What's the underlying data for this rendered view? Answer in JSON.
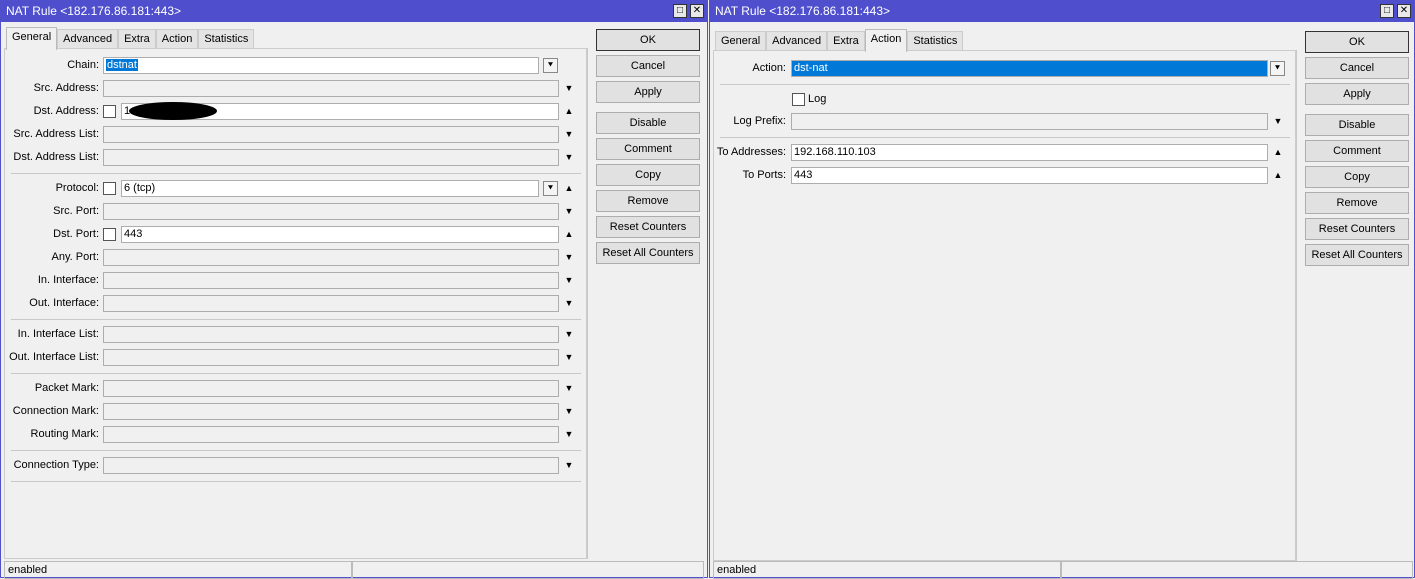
{
  "left": {
    "title": "NAT Rule <182.176.86.181:443>",
    "tabs": [
      "General",
      "Advanced",
      "Extra",
      "Action",
      "Statistics"
    ],
    "active_tab": 0,
    "fields": [
      {
        "label": "Chain:",
        "value": "dstnat",
        "selected": true,
        "dropdown": true,
        "enabled": true
      },
      {
        "label": "Src. Address:",
        "value": "",
        "arrow": "down"
      },
      {
        "label": "Dst. Address:",
        "value": "1",
        "checkbox": true,
        "arrow": "up",
        "enabled": true,
        "redacted": true
      },
      {
        "label": "Src. Address List:",
        "value": "",
        "arrow": "down"
      },
      {
        "label": "Dst. Address List:",
        "value": "",
        "arrow": "down"
      },
      {
        "label": "Protocol:",
        "value": "6 (tcp)",
        "checkbox": true,
        "dropdown": true,
        "arrow": "up",
        "enabled": true
      },
      {
        "label": "Src. Port:",
        "value": "",
        "arrow": "down"
      },
      {
        "label": "Dst. Port:",
        "value": "443",
        "checkbox": true,
        "arrow": "up",
        "enabled": true
      },
      {
        "label": "Any. Port:",
        "value": "",
        "arrow": "down"
      },
      {
        "label": "In. Interface:",
        "value": "",
        "arrow": "down"
      },
      {
        "label": "Out. Interface:",
        "value": "",
        "arrow": "down"
      },
      {
        "label": "In. Interface List:",
        "value": "",
        "arrow": "down"
      },
      {
        "label": "Out. Interface List:",
        "value": "",
        "arrow": "down"
      },
      {
        "label": "Packet Mark:",
        "value": "",
        "arrow": "down"
      },
      {
        "label": "Connection Mark:",
        "value": "",
        "arrow": "down"
      },
      {
        "label": "Routing Mark:",
        "value": "",
        "arrow": "down"
      },
      {
        "label": "Connection Type:",
        "value": "",
        "arrow": "down"
      }
    ],
    "status": "enabled"
  },
  "right": {
    "title": "NAT Rule <182.176.86.181:443>",
    "tabs": [
      "General",
      "Advanced",
      "Extra",
      "Action",
      "Statistics"
    ],
    "active_tab": 3,
    "action": {
      "label": "Action:",
      "value": "dst-nat"
    },
    "log": {
      "label": "Log",
      "checked": false
    },
    "fields": [
      {
        "label": "Log Prefix:",
        "value": "",
        "arrow": "down"
      },
      {
        "label": "To Addresses:",
        "value": "192.168.110.103",
        "arrow": "up",
        "enabled": true
      },
      {
        "label": "To Ports:",
        "value": "443",
        "arrow": "up",
        "enabled": true
      }
    ],
    "status": "enabled"
  },
  "buttons": [
    "OK",
    "Cancel",
    "Apply",
    "Disable",
    "Comment",
    "Copy",
    "Remove",
    "Reset Counters",
    "Reset All Counters"
  ],
  "icons": {
    "maximize": "□",
    "close": "✕"
  }
}
